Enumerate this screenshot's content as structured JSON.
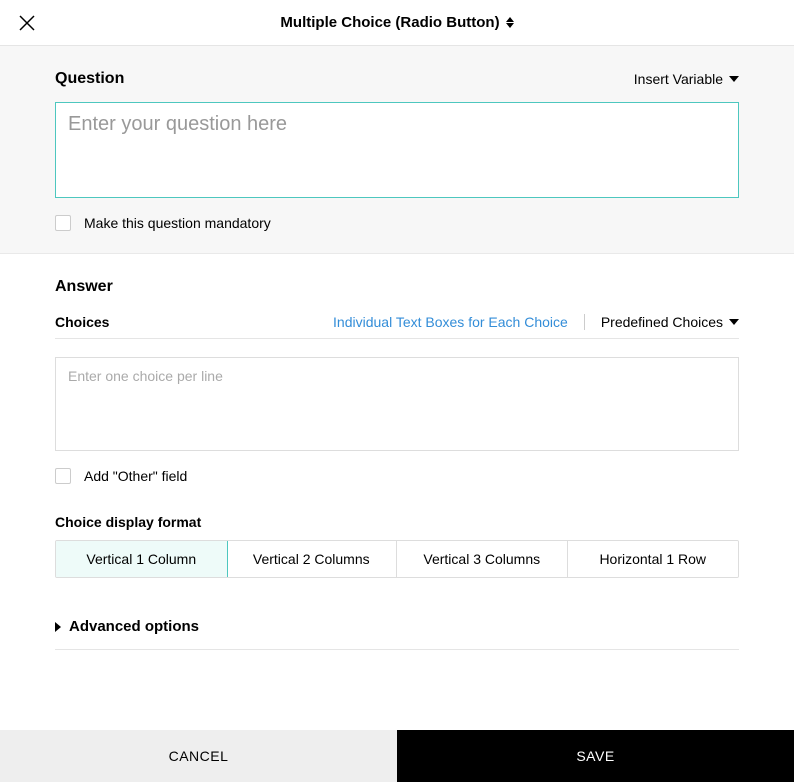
{
  "header": {
    "title": "Multiple Choice (Radio Button)"
  },
  "question": {
    "label": "Question",
    "insert_variable": "Insert Variable",
    "placeholder": "Enter your question here",
    "value": "",
    "mandatory_label": "Make this question mandatory"
  },
  "answer": {
    "label": "Answer",
    "choices_label": "Choices",
    "individual_link": "Individual Text Boxes for Each Choice",
    "predefined_label": "Predefined Choices",
    "choices_placeholder": "Enter one choice per line",
    "choices_value": "",
    "other_label": "Add \"Other\" field",
    "format_label": "Choice display format",
    "format_options": [
      "Vertical 1 Column",
      "Vertical 2 Columns",
      "Vertical 3 Columns",
      "Horizontal 1 Row"
    ],
    "format_selected_index": 0,
    "advanced_label": "Advanced options"
  },
  "footer": {
    "cancel": "CANCEL",
    "save": "SAVE"
  }
}
